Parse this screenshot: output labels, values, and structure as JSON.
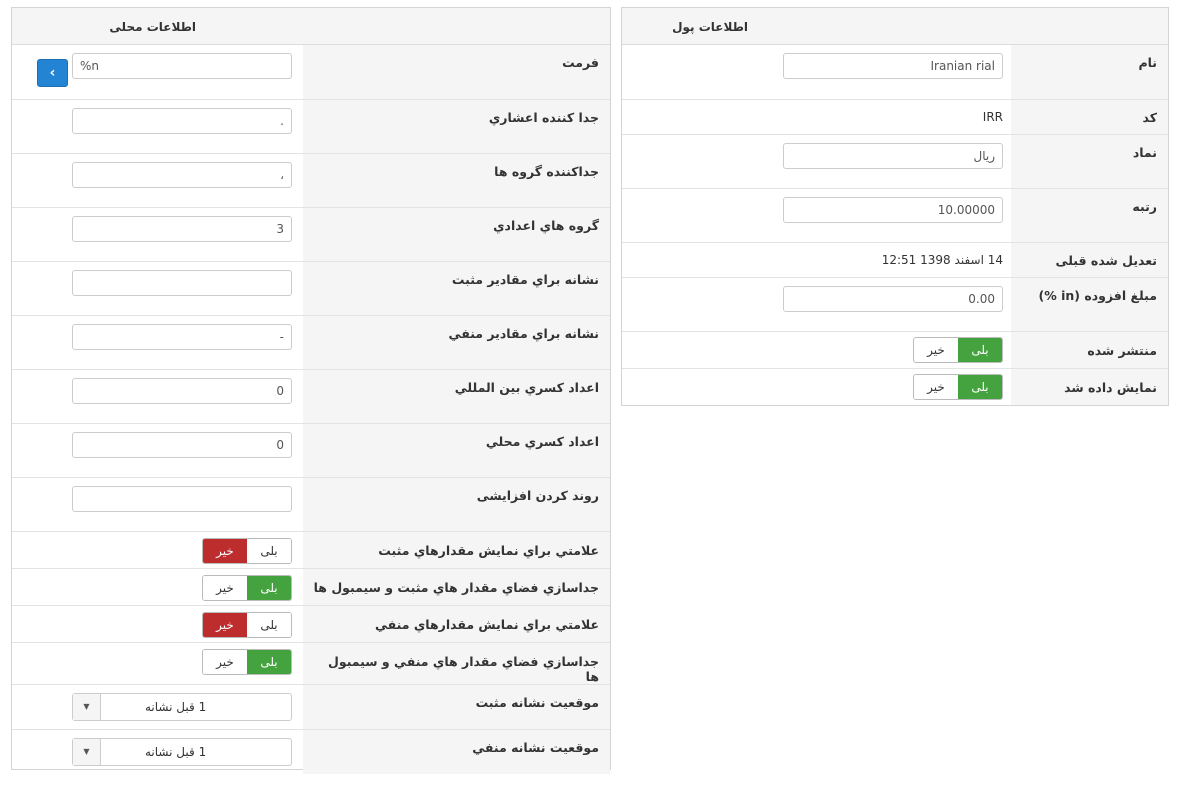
{
  "money_panel": {
    "title": "اطلاعات پول",
    "fields": {
      "name": {
        "label": "نام",
        "value": "Iranian rial"
      },
      "code": {
        "label": "کد",
        "value": "IRR"
      },
      "symbol": {
        "label": "نماد",
        "value": "ریال"
      },
      "rank": {
        "label": "رتبه",
        "value": "10.00000"
      },
      "last_modified": {
        "label": "تعدیل شده قبلی",
        "value": "14 اسفند 1398 12:51"
      },
      "added_amount": {
        "label": "مبلغ افزوده (in %)",
        "value": "0.00"
      },
      "published": {
        "label": "منتشر شده",
        "yes": "بلی",
        "no": "خیر"
      },
      "displayed": {
        "label": "نمایش داده شد",
        "yes": "بلی",
        "no": "خیر"
      }
    }
  },
  "locale_panel": {
    "title": "اطلاعات محلی",
    "format": {
      "label": "فرمت",
      "value": "%n",
      "button": "›"
    },
    "decimal_separator": {
      "label": "جدا کننده اعشاري",
      "value": "."
    },
    "group_separator": {
      "label": "جداكننده گروه ها",
      "value": "،"
    },
    "digit_groups": {
      "label": "گروه هاي اعدادي",
      "value": "3"
    },
    "positive_sign": {
      "label": "نشانه براي مقادير مثبت",
      "value": ""
    },
    "negative_sign": {
      "label": "نشانه براي مقادير منفي",
      "value": "-"
    },
    "intl_fraction_digits": {
      "label": "اعداد كسري بين المللي",
      "value": "0"
    },
    "local_fraction_digits": {
      "label": "اعداد كسري محلي",
      "value": "0"
    },
    "rounding_increment": {
      "label": "روند کردن افزایشی",
      "value": ""
    },
    "pos_sign_display": {
      "label": "علامتي براي نمايش مقدارهاي مثبت",
      "yes": "بلی",
      "no": "خیر"
    },
    "pos_space": {
      "label": "جداسازي فضاي مقدار هاي مثبت و سيمبول ها",
      "yes": "بلی",
      "no": "خیر"
    },
    "neg_sign_display": {
      "label": "علامتي براي نمايش مقدارهاي منفي",
      "yes": "بلی",
      "no": "خیر"
    },
    "neg_space": {
      "label": "جداسازي فضاي مقدار هاي منفي و سيمبول ها",
      "yes": "بلی",
      "no": "خیر"
    },
    "pos_sign_position": {
      "label": "موقعيت نشانه مثبت",
      "value": "1 قبل نشانه"
    },
    "neg_sign_position": {
      "label": "موقعيت نشانه منفي",
      "value": "1 قبل نشانه"
    }
  },
  "colors": {
    "yes_active": "#45a33f",
    "no_active": "#bd2d2d",
    "primary": "#2384d3"
  }
}
